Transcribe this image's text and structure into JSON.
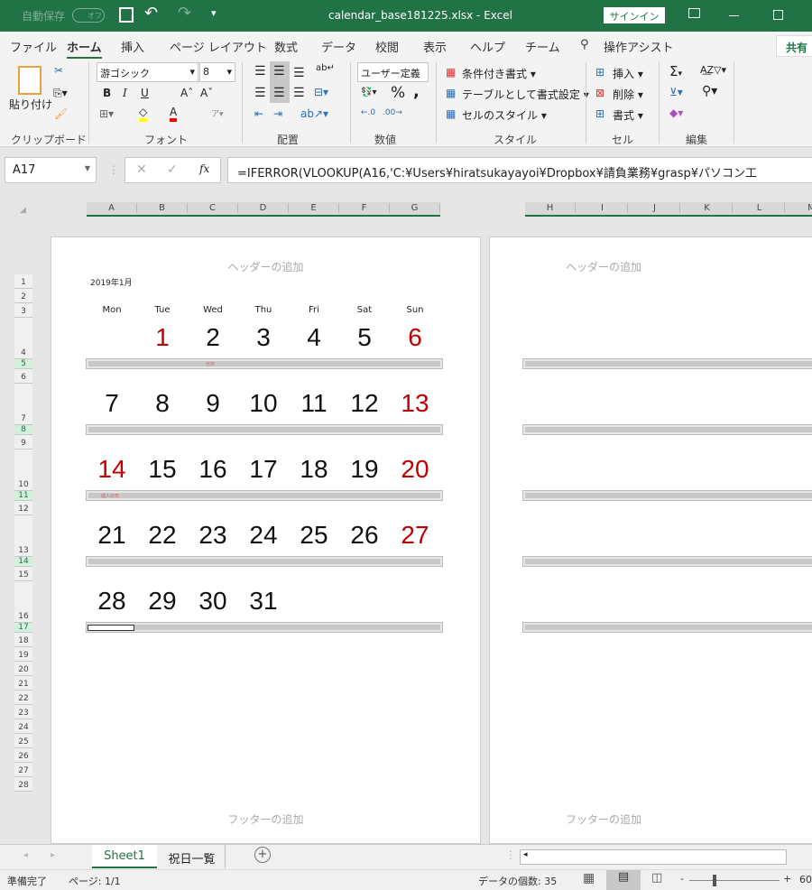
{
  "titlebar": {
    "autosave_label": "自動保存",
    "autosave_state": "オフ",
    "filename": "calendar_base181225.xlsx",
    "app": "Excel",
    "separator": "-",
    "signin": "サインイン"
  },
  "ribbon_tabs": [
    "ファイル",
    "ホーム",
    "挿入",
    "ページ レイアウト",
    "数式",
    "データ",
    "校閲",
    "表示",
    "ヘルプ",
    "チーム"
  ],
  "active_tab": "ホーム",
  "tell_me": "操作アシスト",
  "share": "共有",
  "clipboard": {
    "paste": "貼り付け",
    "group": "クリップボード"
  },
  "font": {
    "name": "游ゴシック",
    "size": "8",
    "group": "フォント",
    "bold": "B",
    "italic": "I",
    "underline": "U",
    "fill_color": "#ffff00",
    "font_color": "#ff0000"
  },
  "alignment": {
    "group": "配置"
  },
  "number": {
    "format": "ユーザー定義",
    "group": "数値",
    "percent": "%",
    "comma": ","
  },
  "styles": {
    "conditional": "条件付き書式",
    "table": "テーブルとして書式設定",
    "cell_styles": "セルのスタイル",
    "group": "スタイル"
  },
  "cells": {
    "insert": "挿入",
    "delete": "削除",
    "format": "書式",
    "group": "セル"
  },
  "editing": {
    "group": "編集",
    "sum": "Σ"
  },
  "formula_bar": {
    "name_box": "A17",
    "fx": "fx",
    "formula": "=IFERROR(VLOOKUP(A16,'C:¥Users¥hiratsukayayoi¥Dropbox¥請負業務¥grasp¥パソコン工"
  },
  "columns_left": [
    "A",
    "B",
    "C",
    "D",
    "E",
    "F",
    "G"
  ],
  "columns_right": [
    "H",
    "I",
    "J",
    "K",
    "L",
    "M"
  ],
  "rows": [
    "1",
    "2",
    "3",
    "4",
    "5",
    "6",
    "7",
    "8",
    "9",
    "10",
    "11",
    "12",
    "13",
    "14",
    "15",
    "16",
    "17",
    "18",
    "19",
    "20",
    "21",
    "22",
    "23",
    "24",
    "25",
    "26",
    "27",
    "28"
  ],
  "page": {
    "header": "ヘッダーの追加",
    "footer": "フッターの追加"
  },
  "calendar": {
    "month_label": "2019年1月",
    "weekdays": [
      "Mon",
      "Tue",
      "Wed",
      "Thu",
      "Fri",
      "Sat",
      "Sun"
    ],
    "weeks": [
      [
        "",
        "1",
        "2",
        "3",
        "4",
        "5",
        "6"
      ],
      [
        "7",
        "8",
        "9",
        "10",
        "11",
        "12",
        "13"
      ],
      [
        "14",
        "15",
        "16",
        "17",
        "18",
        "19",
        "20"
      ],
      [
        "21",
        "22",
        "23",
        "24",
        "25",
        "26",
        "27"
      ],
      [
        "28",
        "29",
        "30",
        "31",
        "",
        "",
        ""
      ]
    ],
    "red_days": [
      "1",
      "6",
      "13",
      "14",
      "20",
      "27"
    ],
    "holidays": [
      {
        "week": 0,
        "col": 1,
        "name": "元日"
      },
      {
        "week": 2,
        "col": 0,
        "name": "成人の日"
      }
    ],
    "holiday_color": "#c00000"
  },
  "sheets": [
    "Sheet1",
    "祝日一覧"
  ],
  "active_sheet": "Sheet1",
  "status": {
    "ready": "準備完了",
    "page": "ページ: 1/1",
    "count": "データの個数: 35",
    "zoom": "60"
  }
}
